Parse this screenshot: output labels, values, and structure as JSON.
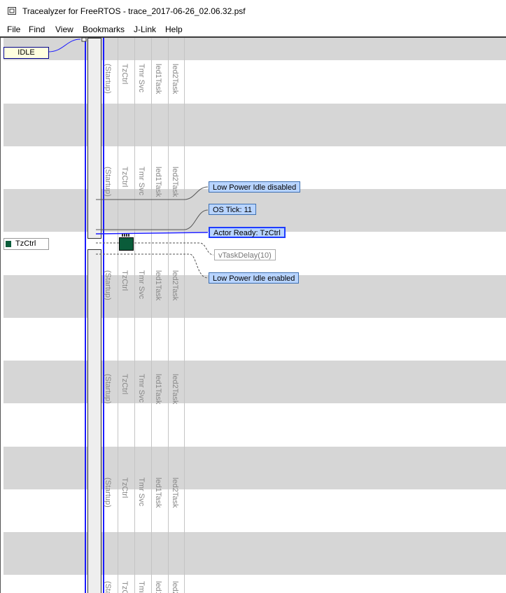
{
  "window": {
    "title": "Tracealyzer for FreeRTOS - trace_2017-06-26_02.06.32.psf"
  },
  "menu": {
    "items": [
      "File",
      "Find",
      "View",
      "Bookmarks",
      "J-Link",
      "Help"
    ]
  },
  "actors": {
    "idle": "IDLE",
    "tzctrl": "TzCtrl"
  },
  "column_labels": [
    "(Startup)",
    "TzCtrl",
    "Tmr Svc",
    "led1Task",
    "led2Task"
  ],
  "events": {
    "low_power_disabled": "Low Power Idle disabled",
    "os_tick": "OS Tick: 11",
    "actor_ready": "Actor Ready: TzCtrl",
    "task_delay": "vTaskDelay(10)",
    "low_power_enabled": "Low Power Idle enabled"
  },
  "colors": {
    "band": "#d6d6d6",
    "accent": "#1c1cff",
    "event_fill": "#b8d4ff",
    "task_color": "#0a5c3a"
  }
}
